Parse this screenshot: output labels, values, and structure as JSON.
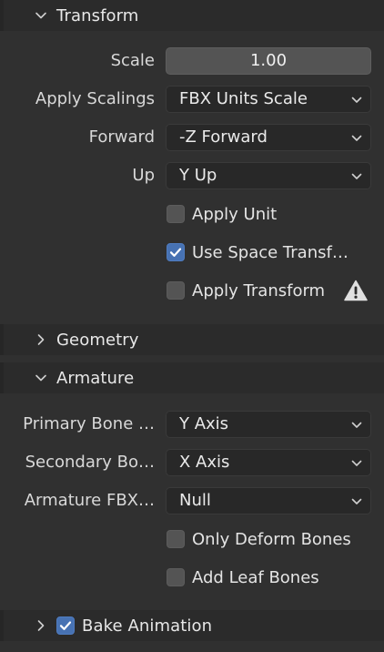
{
  "transform": {
    "header": "Transform",
    "scale_label": "Scale",
    "scale_value": "1.00",
    "apply_scalings_label": "Apply Scalings",
    "apply_scalings_value": "FBX Units Scale",
    "forward_label": "Forward",
    "forward_value": "-Z Forward",
    "up_label": "Up",
    "up_value": "Y Up",
    "apply_unit_label": "Apply Unit",
    "apply_unit_checked": false,
    "use_space_transform_label": "Use Space Transf…",
    "use_space_transform_checked": true,
    "apply_transform_label": "Apply Transform",
    "apply_transform_checked": false
  },
  "geometry": {
    "header": "Geometry"
  },
  "armature": {
    "header": "Armature",
    "primary_bone_label": "Primary Bone …",
    "primary_bone_value": "Y Axis",
    "secondary_bone_label": "Secondary Bo…",
    "secondary_bone_value": "X Axis",
    "armature_fbx_label": "Armature FBX…",
    "armature_fbx_value": "Null",
    "only_deform_bones_label": "Only Deform Bones",
    "only_deform_bones_checked": false,
    "add_leaf_bones_label": "Add Leaf Bones",
    "add_leaf_bones_checked": false
  },
  "bake_animation": {
    "header": "Bake Animation",
    "checked": true
  },
  "icons": {
    "expanded": "chevron-down-icon",
    "collapsed": "chevron-right-icon",
    "dropdown": "chevron-down-icon",
    "check": "checkmark-icon",
    "warning": "warning-icon"
  },
  "colors": {
    "accent": "#4772b3",
    "panel_bg": "#303030",
    "header_bg": "#2b2b2b",
    "field_bg": "#545454",
    "dropdown_bg": "#282828"
  }
}
